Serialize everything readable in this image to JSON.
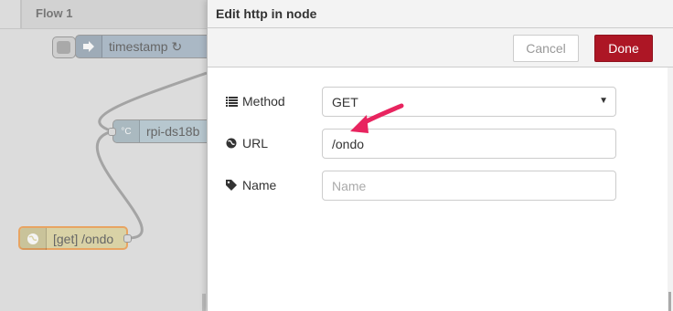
{
  "workspace": {
    "tab_label": "Flow 1",
    "nodes": [
      {
        "label": "timestamp ↻",
        "icon": "arrow-right-icon"
      },
      {
        "label": "rpi-ds18b",
        "icon": "thermometer-icon",
        "icon_text": "°C"
      },
      {
        "label": "[get] /ondo",
        "icon": "globe-icon"
      }
    ]
  },
  "tray": {
    "title": "Edit http in node",
    "cancel_label": "Cancel",
    "done_label": "Done",
    "fields": {
      "method": {
        "label": "Method",
        "value": "GET",
        "icon": "list-icon"
      },
      "url": {
        "label": "URL",
        "value": "/ondo",
        "icon": "globe-icon"
      },
      "name": {
        "label": "Name",
        "placeholder": "Name",
        "value": "",
        "icon": "tag-icon"
      }
    }
  },
  "colors": {
    "done_button": "#ad1625",
    "annotation_arrow": "#e8245f",
    "selected_node_border": "#e8a462"
  }
}
